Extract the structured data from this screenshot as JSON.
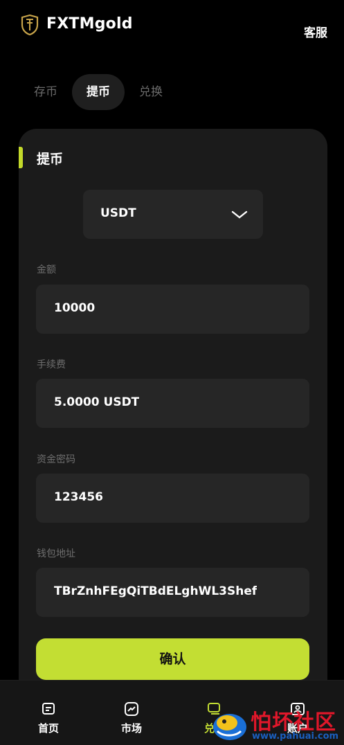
{
  "header": {
    "app_title": "FXTMgold",
    "service_label": "客服"
  },
  "tabs": [
    {
      "label": "存币",
      "active": false
    },
    {
      "label": "提币",
      "active": true
    },
    {
      "label": "兑换",
      "active": false
    }
  ],
  "form": {
    "title": "提币",
    "currency": "USDT",
    "amount_label": "金额",
    "amount_value": "10000",
    "fee_label": "手续费",
    "fee_value": "5.0000 USDT",
    "password_label": "资金密码",
    "password_value": "123456",
    "wallet_label": "钱包地址",
    "wallet_value": "TBrZnhFEgQiTBdELghWL3Shef",
    "confirm_label": "确认"
  },
  "bottom_nav": [
    {
      "label": "首页",
      "icon": "home-icon"
    },
    {
      "label": "市场",
      "icon": "market-icon"
    },
    {
      "label": "兑换",
      "icon": "exchange-icon",
      "active": true
    },
    {
      "label": "账户",
      "icon": "account-icon"
    }
  ],
  "watermark": {
    "text": "怕坏社区",
    "url": "www.pahuai.com"
  },
  "colors": {
    "accent": "#c3de33",
    "card": "#1b1b1b",
    "field": "#262626",
    "background": "#000000"
  }
}
